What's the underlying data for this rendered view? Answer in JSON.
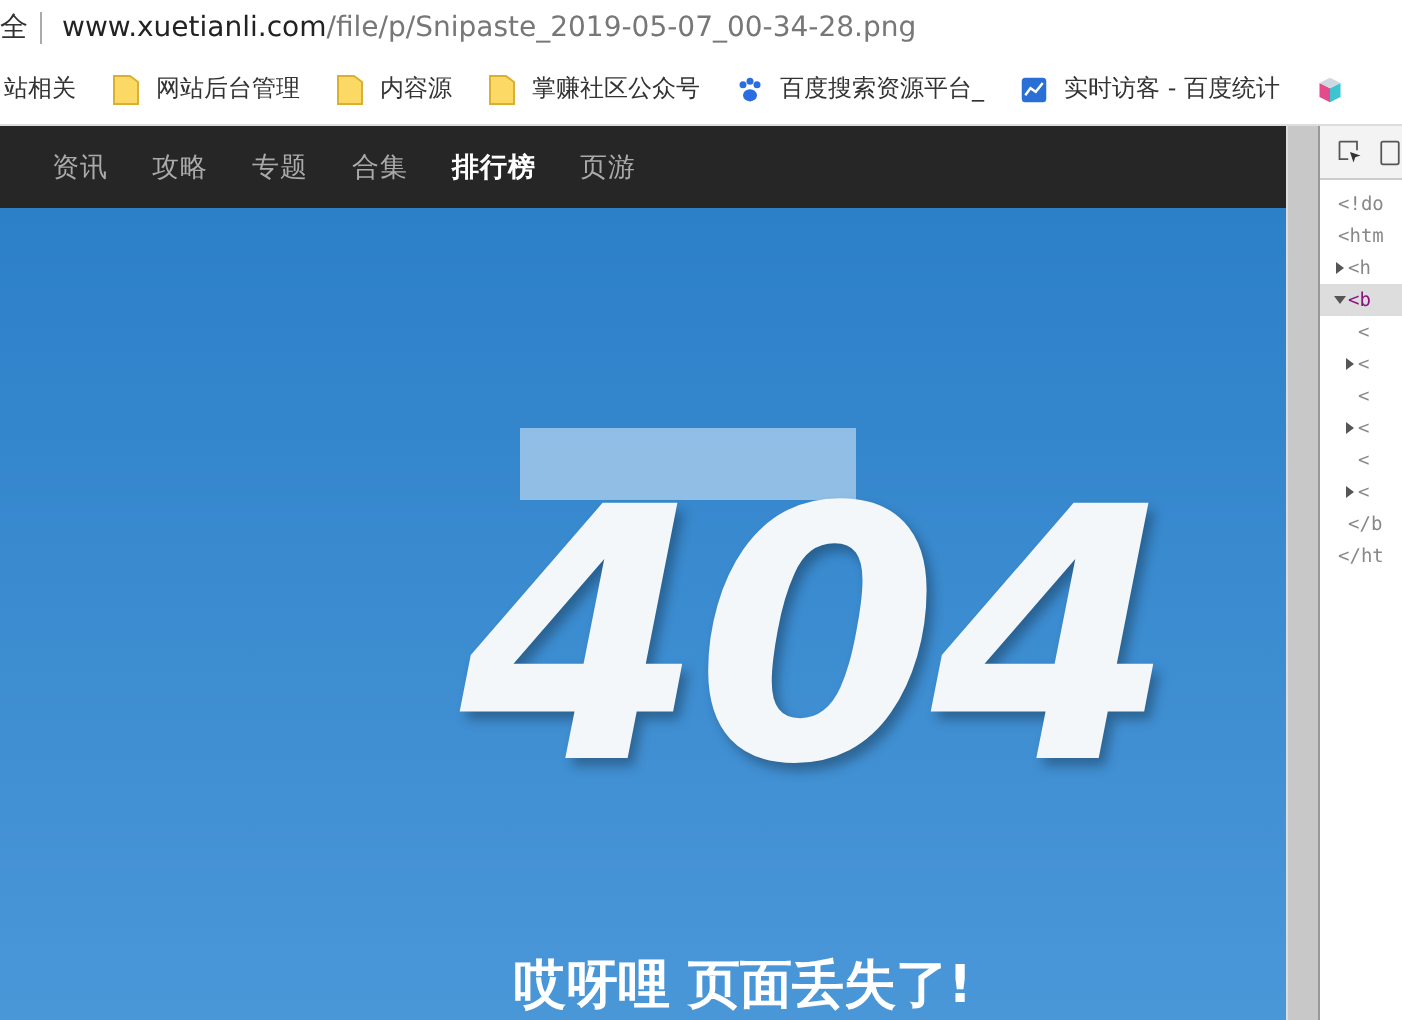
{
  "address_bar": {
    "prefix": "全",
    "host": "www.xuetianli.com",
    "path": "/file/p/Snipaste_2019-05-07_00-34-28.png"
  },
  "bookmarks": [
    {
      "kind": "text",
      "label": "站相关"
    },
    {
      "kind": "folder",
      "label": "网站后台管理"
    },
    {
      "kind": "folder",
      "label": "内容源"
    },
    {
      "kind": "folder",
      "label": "掌赚社区公众号"
    },
    {
      "kind": "paw",
      "label": "百度搜索资源平台_"
    },
    {
      "kind": "chart",
      "label": "实时访客 - 百度统计"
    },
    {
      "kind": "cube"
    }
  ],
  "nav": [
    {
      "label": "资讯",
      "selected": false
    },
    {
      "label": "攻略",
      "selected": false
    },
    {
      "label": "专题",
      "selected": false
    },
    {
      "label": "合集",
      "selected": false
    },
    {
      "label": "排行榜",
      "selected": true
    },
    {
      "label": "页游",
      "selected": false
    }
  ],
  "hero": {
    "code": "404",
    "message": "哎呀哩 页面丢失了!"
  },
  "devtools": {
    "nodes": [
      {
        "text": "<!do",
        "selected": false
      },
      {
        "text": "<htm",
        "selected": false,
        "children": [
          {
            "text": "<h",
            "selected": false,
            "expanded": false
          },
          {
            "text": "<b",
            "selected": true,
            "expanded": true,
            "children": [
              {
                "text": "<",
                "selected": false
              },
              {
                "text": "<",
                "selected": false,
                "expanded": false
              },
              {
                "text": "<",
                "selected": false
              },
              {
                "text": "<",
                "selected": false,
                "expanded": false
              },
              {
                "text": "<",
                "selected": false
              },
              {
                "text": "<",
                "selected": false,
                "expanded": false
              }
            ]
          },
          {
            "text": "</b",
            "selected": false
          }
        ]
      },
      {
        "text": "</ht",
        "selected": false
      }
    ]
  }
}
